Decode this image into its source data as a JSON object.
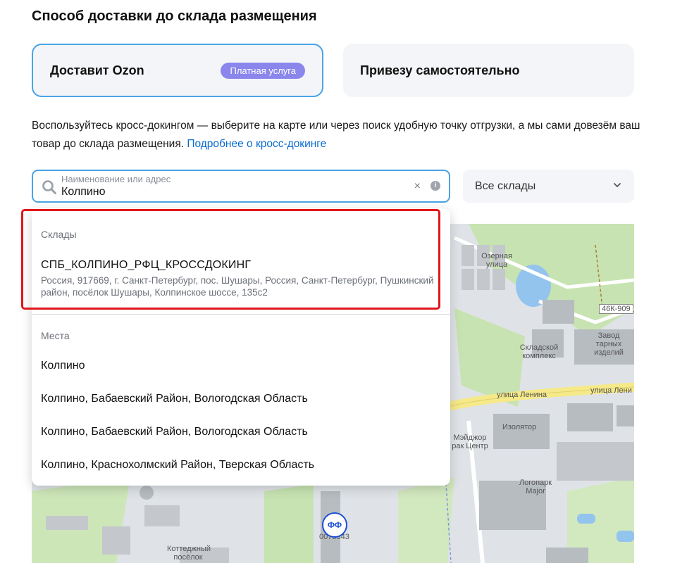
{
  "section_title": "Способ доставки до склада размещения",
  "delivery_options": {
    "ozon": {
      "label": "Доставит Ozon",
      "badge": "Платная услуга",
      "selected": true
    },
    "self": {
      "label": "Привезу самостоятельно",
      "selected": false
    }
  },
  "description": {
    "text": "Воспользуйтесь кросс-докингом — выберите на карте или через поиск удобную точку отгрузки, а мы сами довезём ваш товар до склада размещения. ",
    "link": "Подробнее о кросс-докинге"
  },
  "search": {
    "placeholder": "Наименование или адрес",
    "value": "Колпино",
    "clear_symbol": "×",
    "info_symbol": "i"
  },
  "warehouse_filter": {
    "selected": "Все склады"
  },
  "dropdown": {
    "warehouses_header": "Склады",
    "warehouses": [
      {
        "name": "СПБ_КОЛПИНО_РФЦ_КРОССДОКИНГ",
        "address": "Россия, 917669, г. Санкт-Петербург, пос. Шушары, Россия, Санкт-Петербург, Пушкинский район, посёлок Шушары, Колпинское шоссе, 135с2"
      }
    ],
    "places_header": "Места",
    "places": [
      "Колпино",
      "Колпино, Бабаевский Район, Вологодская Область",
      "Колпино, Бабаевский Район, Вологодская Область",
      "Колпино, Краснохолмский Район, Тверская Область"
    ]
  },
  "map": {
    "labels": {
      "lake_street": "Озерная улица",
      "road_46k": "46К-909",
      "factory": "Завод тарных изделий",
      "warehouse_complex": "Складской комплекс",
      "lenina_street_1": "улица Ленина",
      "lenina_street_2": "улица Лени",
      "izolator": "Изолятор",
      "mezhdor": "Мэйджор рак Центр",
      "logopark": "Логопарк Major",
      "cottage": "Коттеджный посёлок",
      "pin_code": "0078343"
    },
    "marker_label": "ФФ"
  },
  "colors": {
    "accent_border": "#4aa3e6",
    "badge_bg": "#8b86ec",
    "link": "#0a6bd0",
    "highlight": "#e0161c",
    "marker": "#1d4fd8"
  }
}
